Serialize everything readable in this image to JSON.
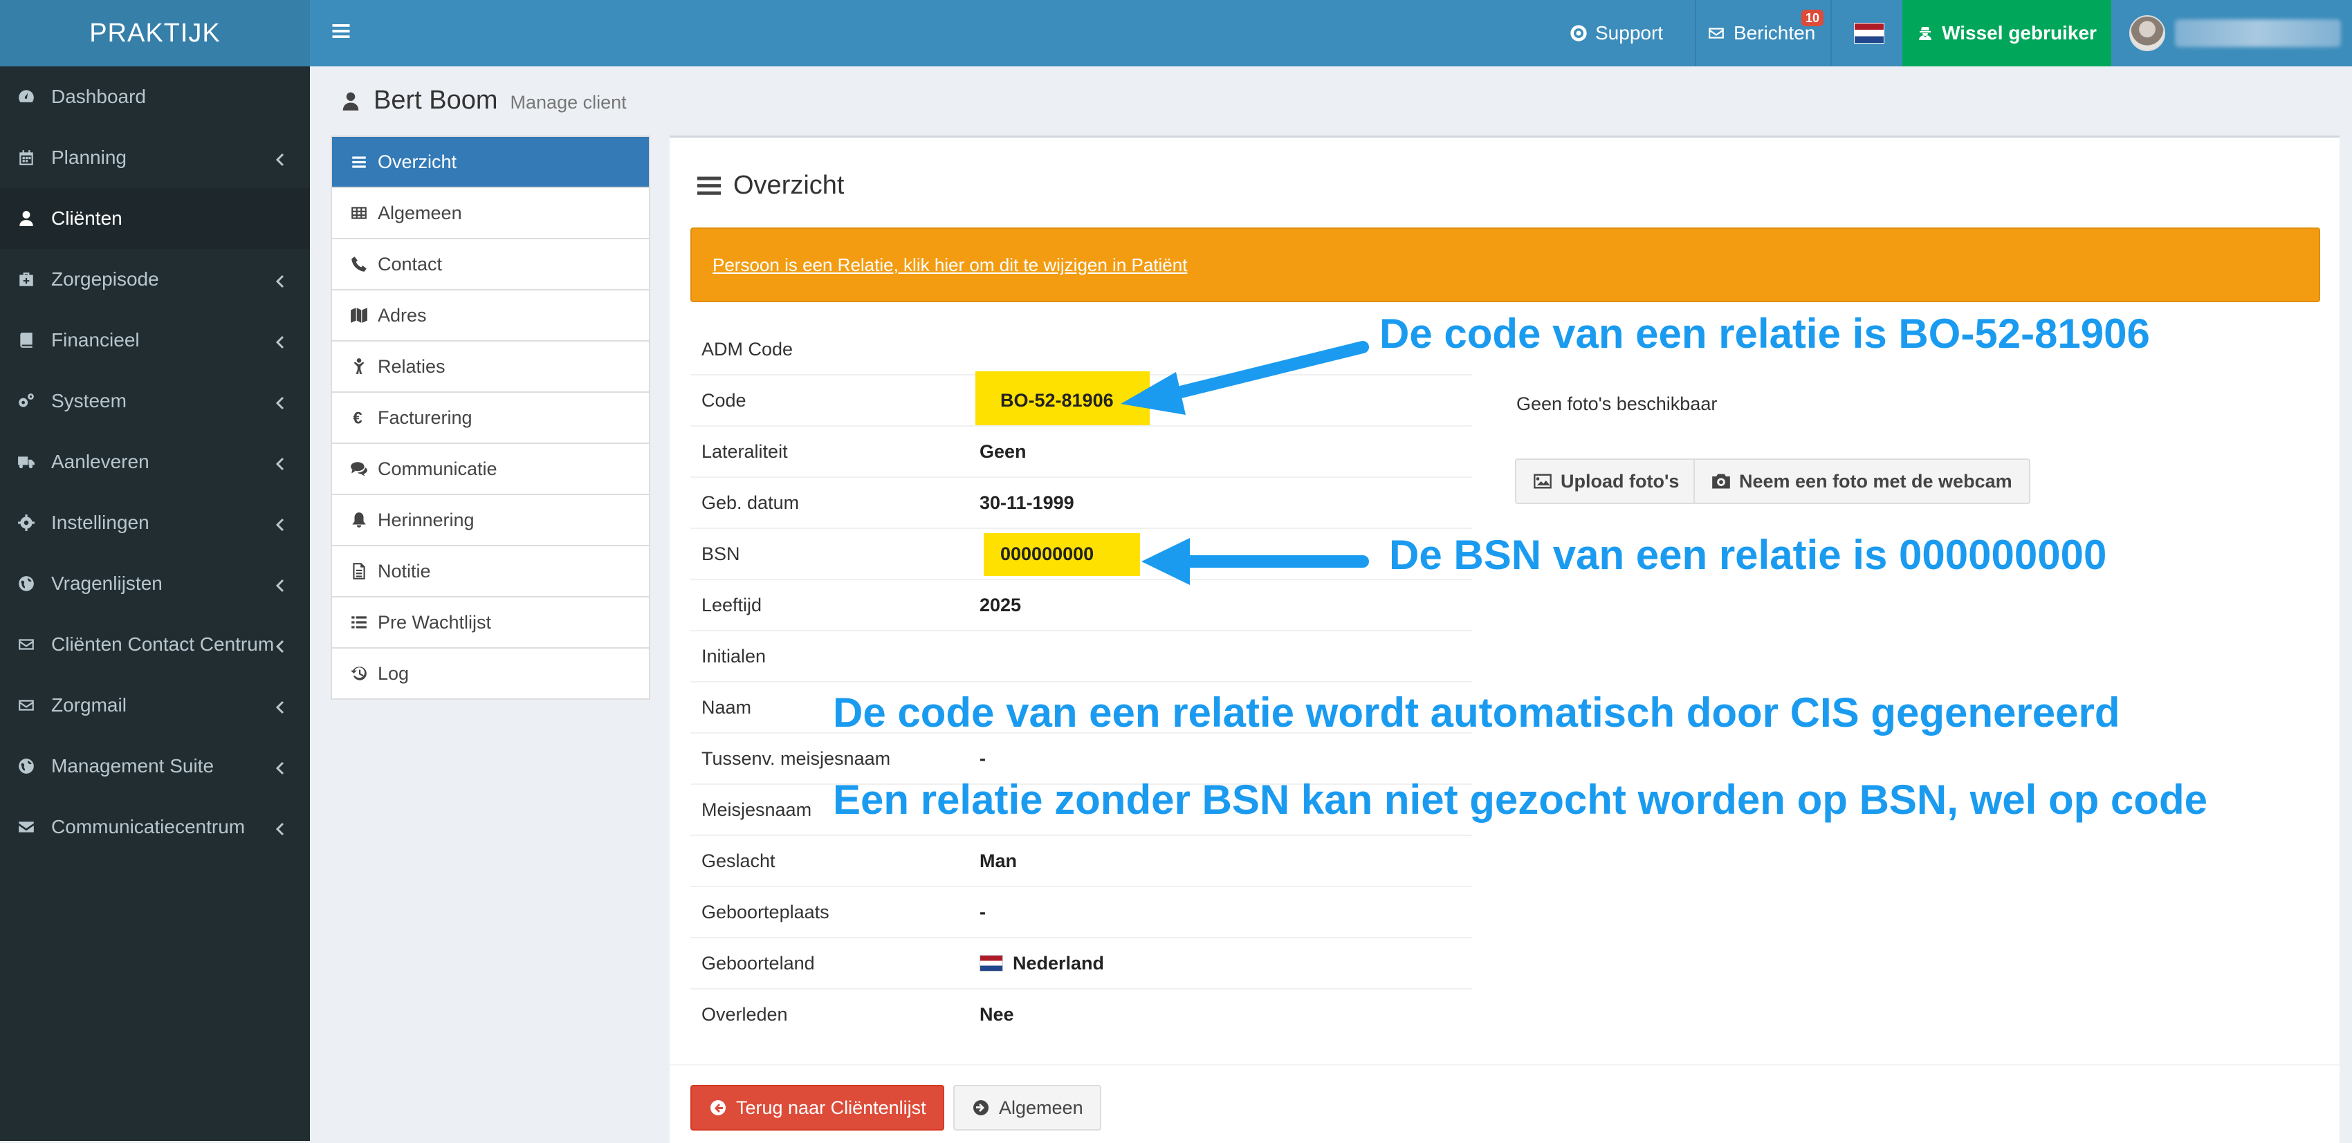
{
  "app": {
    "brand": "PRAKTIJK"
  },
  "sidebar": {
    "items": [
      {
        "label": "Dashboard",
        "icon": "dashboard-icon",
        "chevron": false
      },
      {
        "label": "Planning",
        "icon": "calendar-icon",
        "chevron": true
      },
      {
        "label": "Cliënten",
        "icon": "user-icon",
        "chevron": false,
        "active": true
      },
      {
        "label": "Zorgepisode",
        "icon": "medkit-icon",
        "chevron": true
      },
      {
        "label": "Financieel",
        "icon": "book-icon",
        "chevron": true
      },
      {
        "label": "Systeem",
        "icon": "cogs-icon",
        "chevron": true
      },
      {
        "label": "Aanleveren",
        "icon": "truck-icon",
        "chevron": true
      },
      {
        "label": "Instellingen",
        "icon": "gear-icon",
        "chevron": true
      },
      {
        "label": "Vragenlijsten",
        "icon": "globe-icon",
        "chevron": true
      },
      {
        "label": "Cliënten Contact Centrum",
        "icon": "envelope-icon",
        "chevron": true
      },
      {
        "label": "Zorgmail",
        "icon": "envelope-icon",
        "chevron": true
      },
      {
        "label": "Management Suite",
        "icon": "globe-icon",
        "chevron": true
      },
      {
        "label": "Communicatiecentrum",
        "icon": "envelope-filled-icon",
        "chevron": true
      }
    ]
  },
  "topbar": {
    "support": "Support",
    "berichten": "Berichten",
    "berichten_count": "10",
    "wissel": "Wissel gebruiker"
  },
  "page": {
    "title": "Bert Boom",
    "subtitle": "Manage client"
  },
  "subnav": {
    "items": [
      {
        "label": "Overzicht",
        "active": true
      },
      {
        "label": "Algemeen"
      },
      {
        "label": "Contact"
      },
      {
        "label": "Adres"
      },
      {
        "label": "Relaties"
      },
      {
        "label": "Facturering"
      },
      {
        "label": "Communicatie"
      },
      {
        "label": "Herinnering"
      },
      {
        "label": "Notitie"
      },
      {
        "label": "Pre Wachtlijst"
      },
      {
        "label": "Log"
      }
    ]
  },
  "panel": {
    "title": "Overzicht",
    "alert_link": "Persoon is een Relatie, klik hier om dit te wijzigen in Patiënt",
    "no_photo": "Geen foto's beschikbaar",
    "upload_btn": "Upload foto's",
    "webcam_btn": "Neem een foto met de webcam",
    "back_btn": "Terug naar Cliëntenlijst",
    "algemeen_btn": "Algemeen",
    "colors": {
      "alert": "#f39c12",
      "highlight": "#ffe100",
      "danger": "#dd4b39",
      "annotation": "#1a9bf0"
    }
  },
  "details": [
    {
      "label": "ADM Code",
      "value": ""
    },
    {
      "label": "Code",
      "value": "BO-52-81906",
      "highlight": true
    },
    {
      "label": "Lateraliteit",
      "value": "Geen"
    },
    {
      "label": "Geb. datum",
      "value": "30-11-1999"
    },
    {
      "label": "BSN",
      "value": "000000000",
      "highlight": true
    },
    {
      "label": "Leeftijd",
      "value": "2025"
    },
    {
      "label": "Initialen",
      "value": ""
    },
    {
      "label": "Naam",
      "value": ""
    },
    {
      "label": "Tussenv. meisjesnaam",
      "value": "-"
    },
    {
      "label": "Meisjesnaam",
      "value": ""
    },
    {
      "label": "Geslacht",
      "value": "Man"
    },
    {
      "label": "Geboorteplaats",
      "value": "-"
    },
    {
      "label": "Geboorteland",
      "value": "Nederland",
      "flag": true
    },
    {
      "label": "Overleden",
      "value": "Nee"
    }
  ],
  "annotations": {
    "code_note": "De code van een relatie is BO-52-81906",
    "bsn_note": "De BSN van een relatie is 000000000",
    "auto_note": "De code van een relatie wordt automatisch door CIS gegenereerd",
    "search_note": "Een relatie zonder BSN kan niet gezocht worden op BSN, wel op code"
  }
}
